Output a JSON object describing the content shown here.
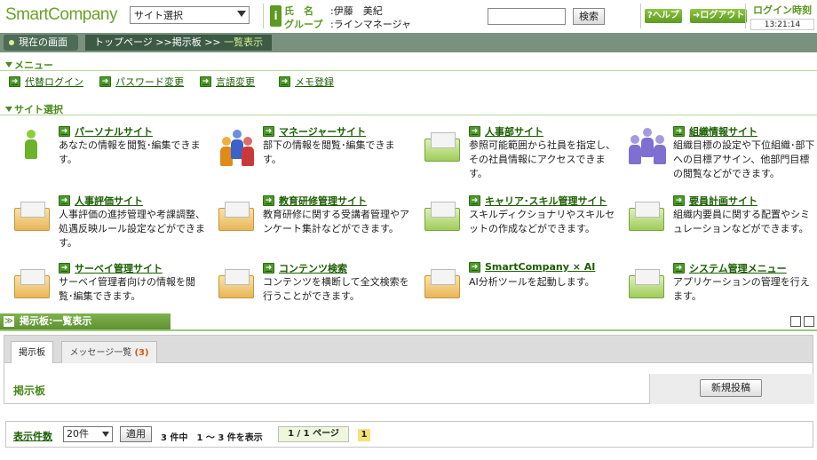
{
  "header": {
    "logo": "SmartCompany",
    "site_select": "サイト選択",
    "user": {
      "name_label": "氏　名",
      "name_value": "伊藤　美紀",
      "group_label": "グループ",
      "group_value": "ラインマネージャ"
    },
    "search_placeholder": "",
    "search_button": "検索",
    "help_button": "ヘルプ",
    "logout_button": "ログアウト",
    "login_time_label": "ログイン時刻",
    "login_time_value": "13:21:14"
  },
  "breadcrumb": {
    "current_label": "現在の画面",
    "path": "トップページ >>掲示板 >> ",
    "current": "一覧表示"
  },
  "menu": {
    "heading": "メニュー",
    "items": [
      "代替ログイン",
      "パスワード変更",
      "言語変更",
      "メモ登録"
    ]
  },
  "sites": {
    "heading": "サイト選択",
    "tiles": [
      {
        "title": "パーソナルサイト",
        "desc": "あなたの情報を閲覧･編集できます。",
        "icon": "person-icon"
      },
      {
        "title": "マネージャーサイト",
        "desc": "部下の情報を閲覧･編集できます。",
        "icon": "team-icon"
      },
      {
        "title": "人事部サイト",
        "desc": "参照可能範囲から社員を指定し、その社員情報にアクセスできます。",
        "icon": "folder-icon"
      },
      {
        "title": "組織情報サイト",
        "desc": "組織目標の設定や下位組織･部下への目標アサイン、他部門目標の閲覧などができます。",
        "icon": "org-icon"
      },
      {
        "title": "人事評価サイト",
        "desc": "人事評価の進捗管理や考課調整、処遇反映ルール設定などができます。",
        "icon": "folder-icon"
      },
      {
        "title": "教育研修管理サイト",
        "desc": "教育研修に関する受講者管理やアンケート集計などができます。",
        "icon": "folder-icon"
      },
      {
        "title": "キャリア･スキル管理サイト",
        "desc": "スキルディクショナリやスキルセットの作成などができます。",
        "icon": "folder-icon"
      },
      {
        "title": "要員計画サイト",
        "desc": "組織内要員に関する配置やシミュレーションなどができます。",
        "icon": "folder-icon"
      },
      {
        "title": "サーベイ管理サイト",
        "desc": "サーベイ管理者向けの情報を閲覧･編集できます。",
        "icon": "folder-icon"
      },
      {
        "title": "コンテンツ検索",
        "desc": "コンテンツを横断して全文検索を行うことができます。",
        "icon": "folder-icon"
      },
      {
        "title": "SmartCompany × AI",
        "desc": "AI分析ツールを起動します。",
        "icon": "folder-icon"
      },
      {
        "title": "システム管理メニュー",
        "desc": "アプリケーションの管理を行えます。",
        "icon": "gear-folder-icon"
      }
    ]
  },
  "bulletin": {
    "panel_title": "掲示板:一覧表示",
    "tab_board": "掲示板",
    "tab_messages": "メッセージ一覧",
    "tab_messages_count": "(3)",
    "board_label": "掲示板",
    "new_post_button": "新規投稿"
  },
  "pager": {
    "label": "表示件数",
    "per_page": "20件",
    "apply": "適用",
    "summary": "3 件中　1 ～ 3 件を表示",
    "pages": "1 / 1 ページ",
    "current_page": "1"
  },
  "colors": {
    "accent": "#5c9a22",
    "link": "#1a5e00",
    "crumb_bg": "#7a9180",
    "panel_header": "#6ea23f"
  }
}
